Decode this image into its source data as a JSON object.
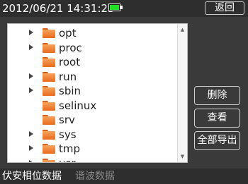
{
  "header": {
    "datetime": "2012/06/21 14:31:23",
    "battery_level": 1.0,
    "back_label": "返回"
  },
  "file_list": {
    "items": [
      {
        "name": "opt",
        "expandable": true
      },
      {
        "name": "proc",
        "expandable": true
      },
      {
        "name": "root",
        "expandable": false
      },
      {
        "name": "run",
        "expandable": true
      },
      {
        "name": "sbin",
        "expandable": true
      },
      {
        "name": "selinux",
        "expandable": false
      },
      {
        "name": "srv",
        "expandable": false
      },
      {
        "name": "sys",
        "expandable": true
      },
      {
        "name": "tmp",
        "expandable": true
      },
      {
        "name": "usr",
        "expandable": true
      }
    ],
    "scroll_up_icon": "up-arrow",
    "scroll_down_icon": "down-arrow"
  },
  "actions": {
    "delete_label": "删除",
    "view_label": "查看",
    "export_all_label": "全部导出"
  },
  "bottom_tabs": [
    {
      "label": "伏安相位数据",
      "active": true
    },
    {
      "label": "谐波数据",
      "active": false
    }
  ],
  "colors": {
    "battery": "#22e022",
    "folder": "#e86b1f",
    "background": "#3a3a3a"
  }
}
